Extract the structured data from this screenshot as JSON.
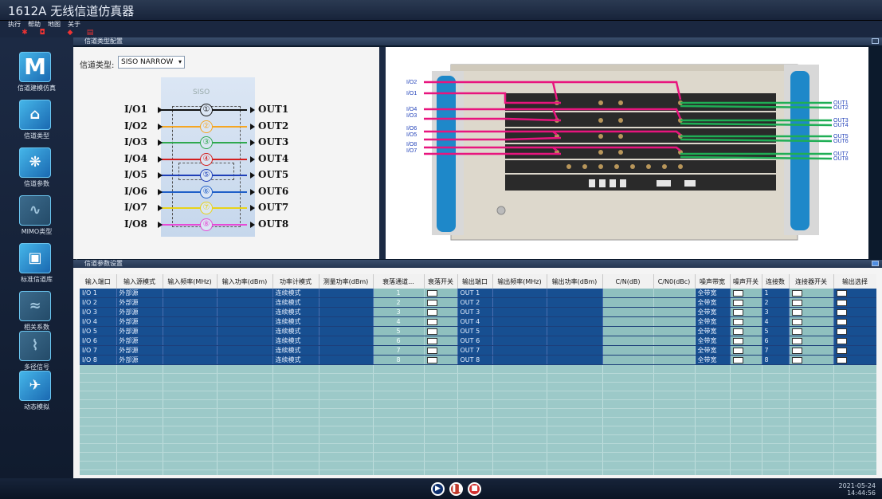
{
  "window": {
    "title": "1612A 无线信道仿真器"
  },
  "menu": [
    "执行",
    "帮助",
    "地图",
    "关于"
  ],
  "toolbar": [
    "power-icon",
    "camera-icon",
    "download-icon",
    "upload-icon"
  ],
  "sidebar": {
    "items": [
      {
        "label": "信道建模仿真",
        "icon": "m-logo-icon",
        "glyph": "M"
      },
      {
        "label": "信道类型",
        "icon": "home-icon",
        "glyph": "⌂"
      },
      {
        "label": "信道参数",
        "icon": "network-icon",
        "glyph": "❋"
      },
      {
        "label": "MIMO类型",
        "icon": "waveform-icon",
        "glyph": "∿"
      },
      {
        "label": "标准信道库",
        "icon": "library-icon",
        "glyph": "▣"
      },
      {
        "label": "相关系数",
        "icon": "correlation-icon",
        "glyph": "≈"
      },
      {
        "label": "多径信号",
        "icon": "multipath-icon",
        "glyph": "⌇"
      },
      {
        "label": "动态模拟",
        "icon": "satellite-icon",
        "glyph": "✈"
      }
    ]
  },
  "config_panel": {
    "title": "信道类型配置",
    "channel_type_label": "信道类型:",
    "channel_type_value": "SISO NARROW",
    "diagram_title": "SISO",
    "inputs": [
      "I/O1",
      "I/O2",
      "I/O3",
      "I/O4",
      "I/O5",
      "I/O6",
      "I/O7",
      "I/O8"
    ],
    "outputs": [
      "OUT1",
      "OUT2",
      "OUT3",
      "OUT4",
      "OUT5",
      "OUT6",
      "OUT7",
      "OUT8"
    ],
    "circles": [
      "①",
      "②",
      "③",
      "④",
      "⑤",
      "⑥",
      "⑦",
      "⑧"
    ],
    "colors": [
      "#111111",
      "#f5a623",
      "#2fa84f",
      "#d32020",
      "#1f3fb8",
      "#1f5fc8",
      "#e8d31a",
      "#e64bd6"
    ]
  },
  "photo_panel": {
    "left_labels": [
      "I/O2",
      "I/O1",
      "I/O4",
      "I/O3",
      "I/O6",
      "I/O5",
      "I/O8",
      "I/O7"
    ],
    "right_labels": [
      "OUT1",
      "OUT2",
      "OUT3",
      "OUT4",
      "OUT5",
      "OUT6",
      "OUT7",
      "OUT8"
    ]
  },
  "param_panel": {
    "title": "信道参数设置",
    "columns": [
      "输入端口",
      "输入源模式",
      "输入频率(MHz)",
      "输入功率(dBm)",
      "功率计模式",
      "测量功率(dBm)",
      "衰落通道...",
      "衰落开关",
      "输出端口",
      "输出频率(MHz)",
      "输出功率(dBm)",
      "C/N(dB)",
      "C/N0(dBc)",
      "噪声带宽",
      "噪声开关",
      "连接数",
      "连接器开关",
      "输出选择"
    ],
    "rows": [
      {
        "in": "I/O 1",
        "src": "外部源",
        "pm": "连续模式",
        "fade": "1",
        "out": "OUT 1",
        "bw": "全带宽",
        "conn": "1"
      },
      {
        "in": "I/O 2",
        "src": "外部源",
        "pm": "连续模式",
        "fade": "2",
        "out": "OUT 2",
        "bw": "全带宽",
        "conn": "2"
      },
      {
        "in": "I/O 3",
        "src": "外部源",
        "pm": "连续模式",
        "fade": "3",
        "out": "OUT 3",
        "bw": "全带宽",
        "conn": "3"
      },
      {
        "in": "I/O 4",
        "src": "外部源",
        "pm": "连续模式",
        "fade": "4",
        "out": "OUT 4",
        "bw": "全带宽",
        "conn": "4"
      },
      {
        "in": "I/O 5",
        "src": "外部源",
        "pm": "连续模式",
        "fade": "5",
        "out": "OUT 5",
        "bw": "全带宽",
        "conn": "5"
      },
      {
        "in": "I/O 6",
        "src": "外部源",
        "pm": "连续模式",
        "fade": "6",
        "out": "OUT 6",
        "bw": "全带宽",
        "conn": "6"
      },
      {
        "in": "I/O 7",
        "src": "外部源",
        "pm": "连续模式",
        "fade": "7",
        "out": "OUT 7",
        "bw": "全带宽",
        "conn": "7"
      },
      {
        "in": "I/O 8",
        "src": "外部源",
        "pm": "连续模式",
        "fade": "8",
        "out": "OUT 8",
        "bw": "全带宽",
        "conn": "8"
      }
    ]
  },
  "status": {
    "date": "2021-05-24",
    "time": "14:44:56"
  }
}
